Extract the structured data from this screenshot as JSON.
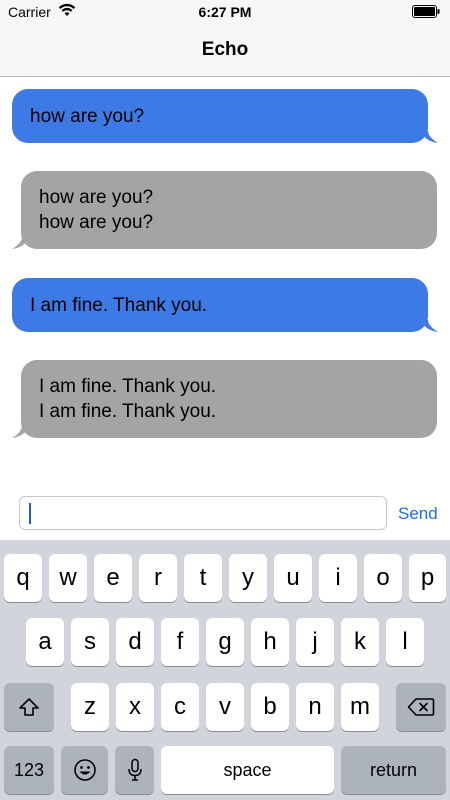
{
  "status_bar": {
    "carrier": "Carrier",
    "time": "6:27 PM"
  },
  "nav": {
    "title": "Echo"
  },
  "messages": [
    {
      "direction": "outgoing",
      "lines": [
        "how are you?"
      ]
    },
    {
      "direction": "incoming",
      "lines": [
        "how are you?",
        "how are you?"
      ]
    },
    {
      "direction": "outgoing",
      "lines": [
        "I am fine. Thank you."
      ]
    },
    {
      "direction": "incoming",
      "lines": [
        "I am fine. Thank you.",
        "I am fine. Thank you."
      ]
    }
  ],
  "composer": {
    "value": "",
    "send_label": "Send"
  },
  "keyboard": {
    "row1": [
      "q",
      "w",
      "e",
      "r",
      "t",
      "y",
      "u",
      "i",
      "o",
      "p"
    ],
    "row2": [
      "a",
      "s",
      "d",
      "f",
      "g",
      "h",
      "j",
      "k",
      "l"
    ],
    "row3": [
      "z",
      "x",
      "c",
      "v",
      "b",
      "n",
      "m"
    ],
    "shift_icon": "shift-arrow-icon",
    "delete_icon": "backspace-icon",
    "numbers_label": "123",
    "emoji_icon": "emoji-icon",
    "mic_icon": "microphone-icon",
    "space_label": "space",
    "return_label": "return"
  },
  "colors": {
    "outgoing_bubble": "#3d7ae6",
    "incoming_bubble": "#a4a4a4",
    "accent": "#1d6fe6",
    "keyboard_bg": "#d1d4da"
  }
}
